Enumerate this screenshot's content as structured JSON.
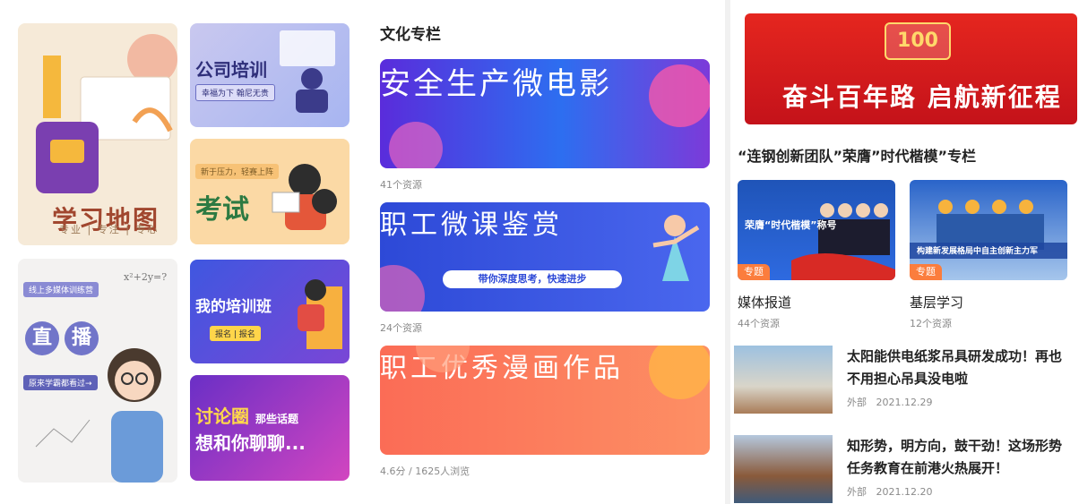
{
  "panel1": {
    "map_tile": {
      "title": "学习地图",
      "subtitle": "专业 | 专注 | 专心"
    },
    "company_tile": {
      "title": "公司培训",
      "tag": "幸福为下 翰尼无贵"
    },
    "exam_tile": {
      "title": "考试",
      "tag": "新于压力，轻赛上阵"
    },
    "live_tile": {
      "tag": "线上多媒体训练营",
      "char1": "直",
      "char2": "播",
      "note": "原来学霸都看过→",
      "formula": "x²+2y=?"
    },
    "training_tile": {
      "title": "我的培训班",
      "tag": "报名 | 报名"
    },
    "forum_tile": {
      "title_a": "讨论圈",
      "title_b": "那些话题",
      "title_c": "想和你聊聊..."
    }
  },
  "panel2": {
    "section_title": "文化专栏",
    "banners": [
      {
        "title": "安全生产微电影",
        "meta": "41个资源"
      },
      {
        "title": "职工微课鉴赏",
        "pill": "带你深度思考，快速进步",
        "meta": "24个资源"
      },
      {
        "title": "职工优秀漫画作品",
        "meta": "4.6分 / 1625人浏览"
      }
    ]
  },
  "panel3": {
    "hero": {
      "emblem": "100",
      "title": "奋斗百年路 启航新征程"
    },
    "section_title": "“连钢创新团队”荣膺”时代楷模”专栏",
    "cards": [
      {
        "tag": "专题",
        "caption": "荣膺“时代楷模”称号",
        "title": "媒体报道",
        "meta": "44个资源"
      },
      {
        "tag": "专题",
        "caption": "构建新发展格局中自主创新主力军",
        "title": "基层学习",
        "meta": "12个资源"
      }
    ],
    "news": [
      {
        "title": "太阳能供电纸浆吊具研发成功！再也不用担心吊具没电啦",
        "source": "外部",
        "date": "2021.12.29"
      },
      {
        "title": "知形势，明方向，鼓干劲！这场形势任务教育在前港火热展开！",
        "source": "外部",
        "date": "2021.12.20"
      }
    ]
  },
  "colors": {
    "accent_orange": "#fb7d3d",
    "hero_red": "#e5261f",
    "meta_gray": "#8a8a8a"
  }
}
